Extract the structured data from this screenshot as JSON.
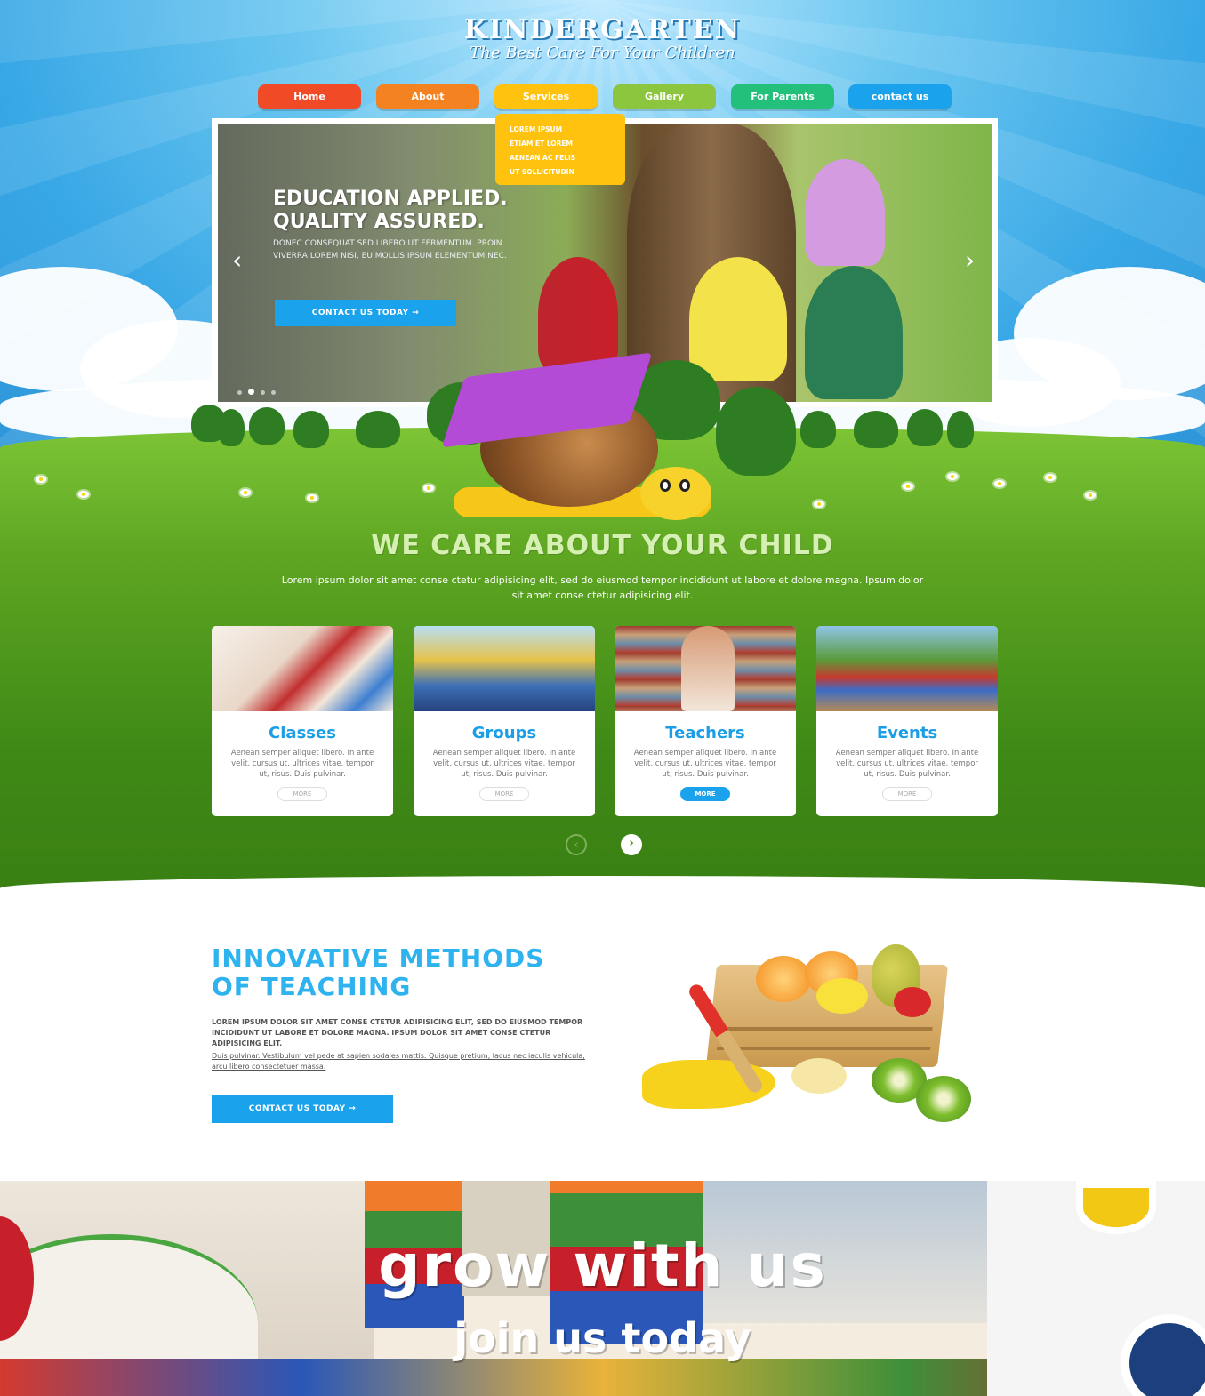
{
  "header": {
    "logo_title": "KINDERGARTEN",
    "logo_subtitle": "The Best Care For Your Children"
  },
  "nav": {
    "items": [
      {
        "label": "Home",
        "color": "#f04a27"
      },
      {
        "label": "About",
        "color": "#f58220"
      },
      {
        "label": "Services",
        "color": "#ffc20e"
      },
      {
        "label": "Gallery",
        "color": "#8cc63f"
      },
      {
        "label": "For Parents",
        "color": "#22c07b"
      },
      {
        "label": "contact us",
        "color": "#1aa3ec"
      }
    ],
    "dropdown": [
      "LOREM IPSUM",
      "ETIAM ET LOREM",
      "AENEAN AC FELIS",
      "UT SOLLICITUDIN"
    ]
  },
  "slider": {
    "heading_line1": "EDUCATION APPLIED.",
    "heading_line2": "QUALITY ASSURED.",
    "text": "DONEC CONSEQUAT SED LIBERO UT FERMENTUM. PROIN VIVERRA LOREM NISI, EU MOLLIS IPSUM ELEMENTUM NEC.",
    "button": "CONTACT US TODAY  →",
    "prev": "‹",
    "next": "›"
  },
  "care": {
    "title": "WE CARE ABOUT YOUR CHILD",
    "text": "Lorem ipsum dolor sit amet conse ctetur adipisicing elit, sed do eiusmod tempor incididunt ut labore et dolore magna. Ipsum dolor sit amet conse ctetur adipisicing elit."
  },
  "cards": [
    {
      "title": "Classes",
      "text": "Aenean semper aliquet libero. In ante velit, cursus ut, ultrices vitae, tempor ut, risus. Duis pulvinar.",
      "button": "MORE",
      "active": false
    },
    {
      "title": "Groups",
      "text": "Aenean semper aliquet libero. In ante velit, cursus ut, ultrices vitae, tempor ut, risus. Duis pulvinar.",
      "button": "MORE",
      "active": false
    },
    {
      "title": "Teachers",
      "text": "Aenean semper aliquet libero. In ante velit, cursus ut, ultrices vitae, tempor ut, risus. Duis pulvinar.",
      "button": "MORE",
      "active": true
    },
    {
      "title": "Events",
      "text": "Aenean semper aliquet libero. In ante velit, cursus ut, ultrices vitae, tempor ut, risus. Duis pulvinar.",
      "button": "MORE",
      "active": false
    }
  ],
  "card_nav": {
    "prev": "‹",
    "next": "›"
  },
  "methods": {
    "title_line1": "INNOVATIVE METHODS",
    "title_line2": "OF TEACHING",
    "bold_text": "LOREM IPSUM DOLOR SIT AMET CONSE CTETUR ADIPISICING ELIT, SED DO EIUSMOD TEMPOR INCIDIDUNT UT LABORE ET DOLORE MAGNA. IPSUM DOLOR SIT AMET CONSE CTETUR ADIPISICING ELIT.",
    "link_text": "Duis pulvinar. Vestibulum vel pede at sapien sodales mattis. Quisque pretium, lacus nec iaculis vehicula, arcu libero consectetuer massa.",
    "button": "CONTACT US TODAY  →"
  },
  "banner": {
    "headline": "grow with us",
    "subline": "join us today"
  }
}
